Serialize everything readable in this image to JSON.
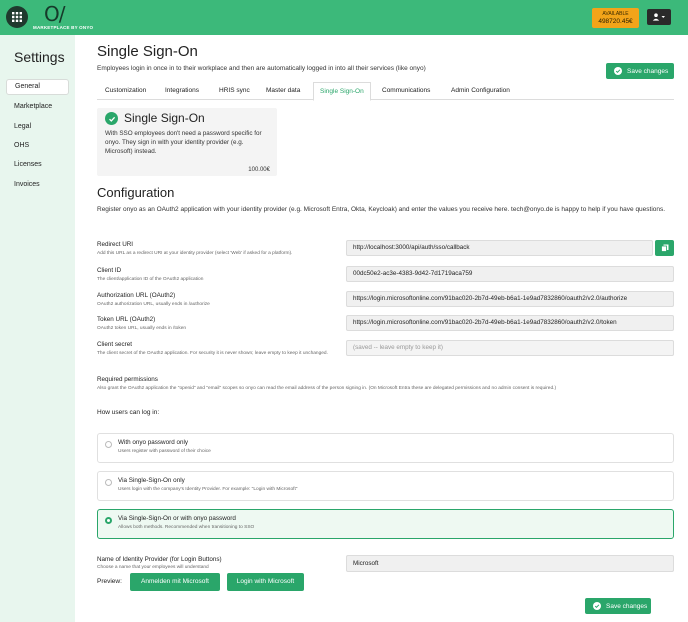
{
  "topbar": {
    "logo": "O/",
    "logo_sub": "MARKETPLACE BY ONYO",
    "available_label": "AVAILABLE",
    "available_value": "498720.45€"
  },
  "sidebar": {
    "title": "Settings",
    "items": [
      {
        "label": "General"
      },
      {
        "label": "Marketplace"
      },
      {
        "label": "Legal"
      },
      {
        "label": "OHS"
      },
      {
        "label": "Licenses"
      },
      {
        "label": "Invoices"
      }
    ]
  },
  "page": {
    "title": "Single Sign-On",
    "subtitle": "Employees login in once in to their workplace and then are automatically logged in into all their services (like onyo)",
    "save_label": "Save changes"
  },
  "tabs": [
    {
      "label": "Customization"
    },
    {
      "label": "Integrations"
    },
    {
      "label": "HRIS sync"
    },
    {
      "label": "Master data"
    },
    {
      "label": "Single Sign-On"
    },
    {
      "label": "Communications"
    },
    {
      "label": "Admin Configuration"
    }
  ],
  "sso_card": {
    "title": "Single Sign-On",
    "description": "With SSO employees don't need a password specific for onyo. They sign in with your identity provider (e.g. Microsoft) instead.",
    "price": "100.00€"
  },
  "config": {
    "title": "Configuration",
    "description": "Register onyo as an OAuth2 application with your identity provider (e.g. Microsoft Entra, Okta, Keycloak) and enter the values you receive here. tech@onyo.de is happy to help if you have questions.",
    "fields": [
      {
        "label": "Redirect URI",
        "help": "Add this URL as a redirect URI at your identity provider (select 'Web' if asked for a platform).",
        "value": "http://localhost:3000/api/auth/sso/callback"
      },
      {
        "label": "Client ID",
        "help": "The client/application ID of the OAuth2 application",
        "value": "00dc50e2-ac3e-4383-9d42-7d1719aca759"
      },
      {
        "label": "Authorization URL (OAuth2)",
        "help": "OAuth2 authorization URL, usually ends in /authorize",
        "value": "https://login.microsoftonline.com/91bac020-2b7d-49eb-b6a1-1e9ad7832860/oauth2/v2.0/authorize"
      },
      {
        "label": "Token URL (OAuth2)",
        "help": "OAuth2 token URL, usually ends in /token",
        "value": "https://login.microsoftonline.com/91bac020-2b7d-49eb-b6a1-1e9ad7832860/oauth2/v2.0/token"
      },
      {
        "label": "Client secret",
        "help": "The client secret of the OAuth2 application. For security it is never shown; leave empty to keep it unchanged.",
        "placeholder": "(saved -- leave empty to keep it)"
      }
    ],
    "required_permissions_label": "Required permissions",
    "required_permissions_help": "Also grant the OAuth2 application the \"openid\" and \"email\" scopes so onyo can read the email address of the person signing in. (On Microsoft Entra these are delegated permissions and no admin consent is required.)"
  },
  "login": {
    "label": "How users can log in:",
    "options": [
      {
        "title": "With onyo password only",
        "sub": "Users register with password of their choice",
        "selected": false
      },
      {
        "title": "Via Single-Sign-On only",
        "sub": "Users login with the company's Identity Provider. For example: \"Login with Microsoft\"",
        "selected": false
      },
      {
        "title": "Via Single-Sign-On or with onyo password",
        "sub": "Allows both methods. Recommended when transitioning to SSO",
        "selected": true
      }
    ]
  },
  "idp": {
    "label": "Name of Identity Provider (for Login Buttons)",
    "help": "Choose a name that your employees will understand",
    "value": "Microsoft",
    "preview_label": "Preview:",
    "preview_buttons": [
      {
        "label": "Anmelden mit Microsoft"
      },
      {
        "label": "Login with Microsoft"
      }
    ]
  },
  "colors": {
    "brand_green": "#3cb97a",
    "button_green": "#2aa66a",
    "available_orange": "#f2a419",
    "sidebar_bg": "#e8f6ee"
  }
}
